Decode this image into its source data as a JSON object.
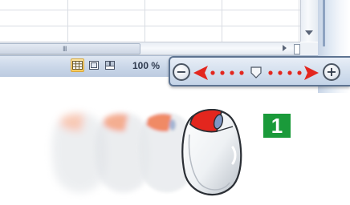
{
  "status_bar": {
    "zoom_level": "100 %",
    "view_buttons": [
      {
        "name": "normal-view",
        "icon": "grid-icon",
        "active": true
      },
      {
        "name": "page-layout-view",
        "icon": "page-layout-icon",
        "active": false
      },
      {
        "name": "page-break-preview",
        "icon": "page-break-icon",
        "active": false
      }
    ]
  },
  "horizontal_scroll": {
    "grip": "III"
  },
  "zoom_slider": {
    "zoom_out_label": "−",
    "zoom_in_label": "+",
    "zoom_out_icon": "minus-circle-icon",
    "zoom_in_icon": "plus-circle-icon",
    "arrow_color": "#e3261e",
    "position_fraction": 0.5
  },
  "illustration": {
    "step_number": "1",
    "badge_color": "#1a9a3a",
    "mouse_button_color": "#e3261e"
  }
}
